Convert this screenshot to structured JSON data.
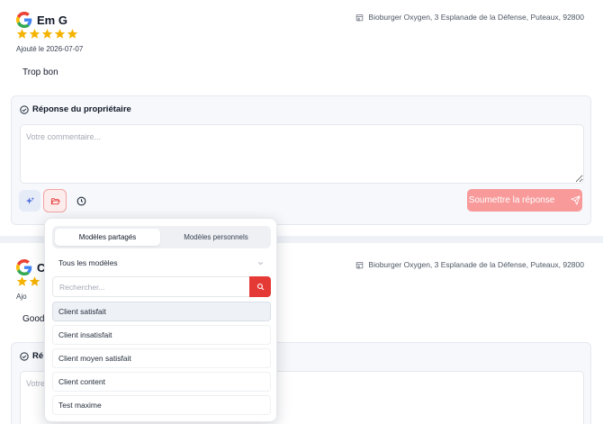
{
  "reviews": [
    {
      "name": "Em G",
      "rating": 5,
      "added": "Ajouté le 2026-07-07",
      "location": "Bioburger Oxygen, 3 Esplanade de la Défense, Puteaux, 92800",
      "comment": "Trop bon"
    },
    {
      "name": "C",
      "rating": 2,
      "added": "Ajo",
      "location": "Bioburger Oxygen, 3 Esplanade de la Défense, Puteaux, 92800",
      "comment": "Good"
    }
  ],
  "reply": {
    "title": "Réponse du propriétaire",
    "title_partial": "Ré",
    "placeholder": "Votre commentaire...",
    "placeholder_partial": "Votre",
    "submit_label": "Soumettre la réponse"
  },
  "templates_popup": {
    "tabs": [
      "Modèles partagés",
      "Modèles personnels"
    ],
    "active_tab": "Modèles partagés",
    "filter_value": "Tous les modèles",
    "search_placeholder": "Rechercher...",
    "items": [
      "Client satisfait",
      "Client insatisfait",
      "Client moyen satisfait",
      "Client content",
      "Test maxime"
    ]
  },
  "colors": {
    "accent": "#e53935",
    "submit_disabled": "#f89a9a",
    "star": "#f5b301"
  },
  "icons": {
    "google": "google-logo-icon",
    "ai": "sparkles-icon",
    "templates": "folder-open-icon",
    "history": "clock-icon",
    "send": "send-icon",
    "search": "search-icon",
    "location": "store-icon",
    "chevron": "chevron-down-icon"
  }
}
